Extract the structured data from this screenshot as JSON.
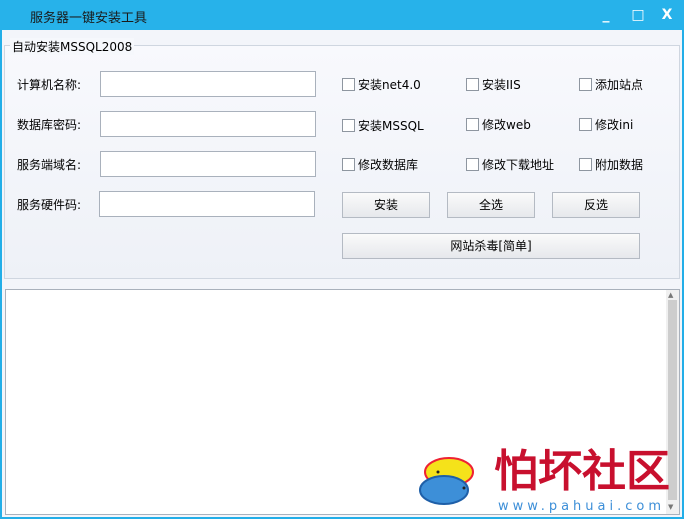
{
  "window": {
    "title": "服务器一键安装工具",
    "minimize": "_",
    "maximize": "□",
    "close": "X"
  },
  "group": {
    "title": "自动安装MSSQL2008"
  },
  "fields": [
    {
      "label": "计算机名称:",
      "value": ""
    },
    {
      "label": "数据库密码:",
      "value": ""
    },
    {
      "label": "服务端域名:",
      "value": ""
    },
    {
      "label": "服务硬件码:",
      "value": ""
    }
  ],
  "checkboxes": [
    {
      "label": "安装net4.0",
      "checked": false
    },
    {
      "label": "安装IIS",
      "checked": false
    },
    {
      "label": "添加站点",
      "checked": false
    },
    {
      "label": "安装MSSQL",
      "checked": false
    },
    {
      "label": "修改web",
      "checked": false
    },
    {
      "label": "修改ini",
      "checked": false
    },
    {
      "label": "修改数据库",
      "checked": false
    },
    {
      "label": "修改下载地址",
      "checked": false
    },
    {
      "label": "附加数据",
      "checked": false
    }
  ],
  "buttons": {
    "install": "安装",
    "select_all": "全选",
    "invert": "反选",
    "antivirus": "网站杀毒[简单]"
  },
  "log": {
    "value": ""
  },
  "watermark": {
    "text": "怕坏社区",
    "url": "www.pahuai.com",
    "colors": {
      "red": "#c8102e",
      "blue": "#3d8fd8"
    }
  }
}
